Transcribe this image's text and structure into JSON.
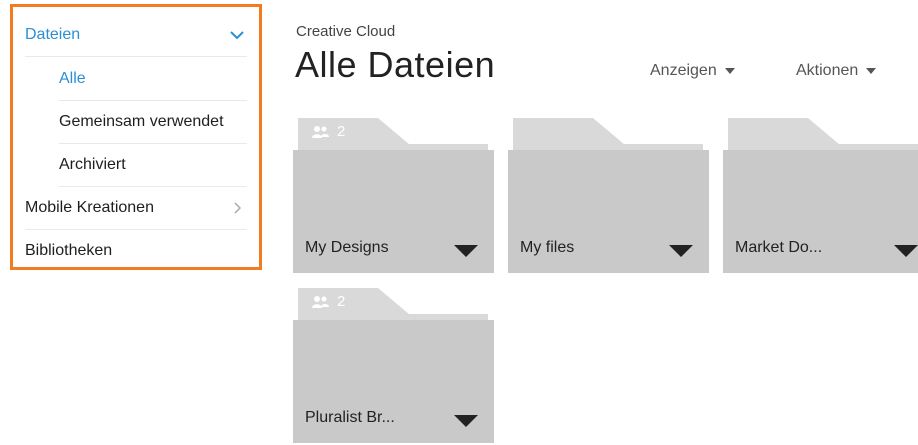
{
  "sidebar": {
    "items": [
      {
        "label": "Dateien"
      },
      {
        "label": "Alle"
      },
      {
        "label": "Gemeinsam verwendet"
      },
      {
        "label": "Archiviert"
      },
      {
        "label": "Mobile Kreationen"
      },
      {
        "label": "Bibliotheken"
      }
    ]
  },
  "header": {
    "eyebrow": "Creative Cloud",
    "title": "Alle Dateien",
    "view_menu": "Anzeigen",
    "actions_menu": "Aktionen"
  },
  "folders": [
    {
      "name": "My Designs",
      "shared_count": "2"
    },
    {
      "name": "My files",
      "shared_count": ""
    },
    {
      "name": "Market Do...",
      "shared_count": ""
    },
    {
      "name": "Pluralist Br...",
      "shared_count": "2"
    }
  ],
  "colors": {
    "accent": "#2b8fd6",
    "highlight_border": "#f47b20",
    "folder_body": "#c9c9c9",
    "folder_tab": "#d9d9d9"
  }
}
